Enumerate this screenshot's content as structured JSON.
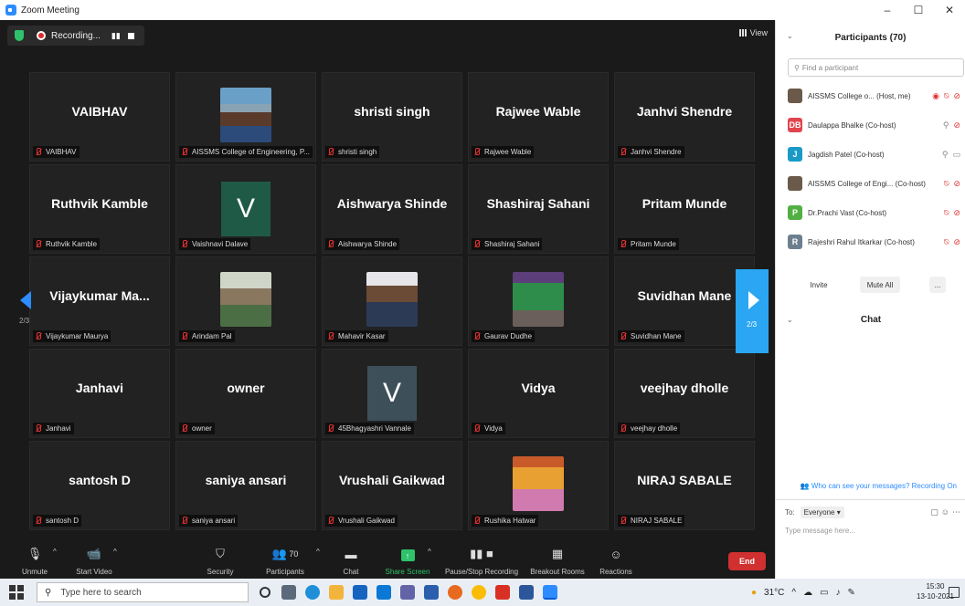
{
  "window": {
    "title": "Zoom Meeting",
    "minimize": "–",
    "maximize": "☐",
    "close": "✕"
  },
  "recording": {
    "text": "Recording...",
    "pause": "▮▮"
  },
  "view": {
    "label": "View"
  },
  "tiles": [
    {
      "name": "VAIBHAV",
      "label": "VAIBHAV",
      "kind": "text"
    },
    {
      "name": "",
      "label": "AISSMS College of Engineering, P...",
      "kind": "photo1"
    },
    {
      "name": "shristi singh",
      "label": "shristi singh",
      "kind": "text"
    },
    {
      "name": "Rajwee Wable",
      "label": "Rajwee Wable",
      "kind": "text"
    },
    {
      "name": "Janhvi Shendre",
      "label": "Janhvi Shendre",
      "kind": "text"
    },
    {
      "name": "Ruthvik Kamble",
      "label": "Ruthvik Kamble",
      "kind": "text"
    },
    {
      "name": "V",
      "label": "Vaishnavi Dalave",
      "kind": "vgreen"
    },
    {
      "name": "Aishwarya Shinde",
      "label": "Aishwarya Shinde",
      "kind": "text"
    },
    {
      "name": "Shashiraj Sahani",
      "label": "Shashiraj Sahani",
      "kind": "text"
    },
    {
      "name": "Pritam Munde",
      "label": "Pritam Munde",
      "kind": "text"
    },
    {
      "name": "Vijaykumar  Ma...",
      "label": "Vijaykumar Maurya",
      "kind": "text"
    },
    {
      "name": "",
      "label": "Arindam Pal",
      "kind": "photo2"
    },
    {
      "name": "",
      "label": "Mahavir Kasar",
      "kind": "photo3"
    },
    {
      "name": "",
      "label": "Gaurav Dudhe",
      "kind": "photo4"
    },
    {
      "name": "Suvidhan Mane",
      "label": "Suvidhan Mane",
      "kind": "text"
    },
    {
      "name": "Janhavi",
      "label": "Janhavi",
      "kind": "text"
    },
    {
      "name": "owner",
      "label": "owner",
      "kind": "text"
    },
    {
      "name": "V",
      "label": "45Bhagyashri Vannale",
      "kind": "vgrey"
    },
    {
      "name": "Vidya",
      "label": "Vidya",
      "kind": "text"
    },
    {
      "name": "veejhay dholle",
      "label": "veejhay dholle",
      "kind": "text"
    },
    {
      "name": "santosh D",
      "label": "santosh D",
      "kind": "text"
    },
    {
      "name": "saniya ansari",
      "label": "saniya ansari",
      "kind": "text"
    },
    {
      "name": "Vrushali Gaikwad",
      "label": "Vrushali Gaikwad",
      "kind": "text"
    },
    {
      "name": "",
      "label": "Rushika Hatwar",
      "kind": "photo5"
    },
    {
      "name": "NIRAJ SABALE",
      "label": "NIRAJ SABALE",
      "kind": "text"
    }
  ],
  "pager": {
    "prev_page": "2/3",
    "next_page": "2/3"
  },
  "toolbar": {
    "unmute": "Unmute",
    "start_video": "Start Video",
    "security": "Security",
    "participants": "Participants",
    "participants_count": "70",
    "chat": "Chat",
    "share_screen": "Share Screen",
    "pause_stop_recording": "Pause/Stop Recording",
    "breakout_rooms": "Breakout Rooms",
    "reactions": "Reactions",
    "end": "End"
  },
  "panel": {
    "title": "Participants (70)",
    "search_placeholder": "Find a participant",
    "participants": [
      {
        "name": "AISSMS College o... (Host, me)",
        "avatar": "",
        "color": "#6b5a4a"
      },
      {
        "name": "Daulappa Bhalke (Co-host)",
        "avatar": "DB",
        "color": "#e0454f"
      },
      {
        "name": "Jagdish Patel (Co-host)",
        "avatar": "J",
        "color": "#1a9bc7"
      },
      {
        "name": "AISSMS College of Engi... (Co-host)",
        "avatar": "",
        "color": "#6b5a4a"
      },
      {
        "name": "Dr.Prachi Vast (Co-host)",
        "avatar": "P",
        "color": "#52b043"
      },
      {
        "name": "Rajeshri Rahul  Itkarkar (Co-host)",
        "avatar": "R",
        "color": "#6d7f8f"
      }
    ],
    "invite": "Invite",
    "mute_all": "Mute All",
    "more": "...",
    "chat_title": "Chat",
    "who_can_see": "Who can see your messages? Recording On",
    "to_label": "To:",
    "to_value": "Everyone",
    "message_placeholder": "Type message here..."
  },
  "taskbar": {
    "search_placeholder": "Type here to search",
    "temperature": "31°C",
    "time": "15:30",
    "date": "13-10-2021"
  }
}
